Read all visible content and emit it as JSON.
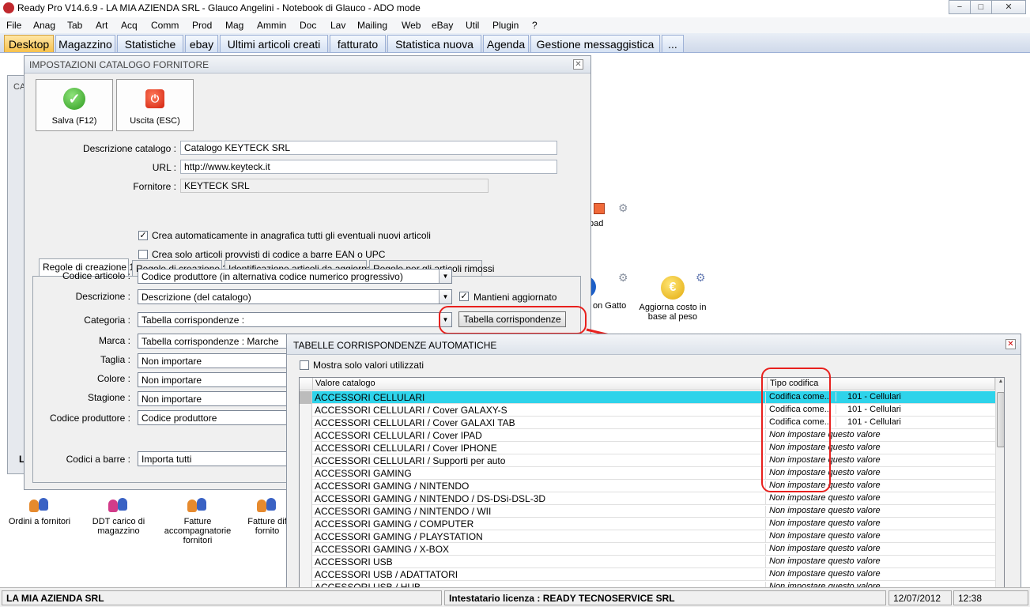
{
  "window": {
    "title": "Ready Pro V14.6.9 - LA MIA AZIENDA SRL - Glauco Angelini - Notebook di Glauco - ADO mode",
    "min": "−",
    "max": "□",
    "close": "✕"
  },
  "menu": [
    "File",
    "Anag",
    "Tab",
    "Art",
    "Acq",
    "Comm",
    "Prod",
    "Mag",
    "Ammin",
    "Doc",
    "Lav",
    "Mailing",
    "Web",
    "eBay",
    "Util",
    "Plugin",
    "?"
  ],
  "tabs": [
    "Desktop",
    "Magazzino",
    "Statistiche",
    "ebay",
    "Ultimi articoli creati",
    "fatturato",
    "Statistica nuova",
    "Agenda",
    "Gestione messaggistica",
    "..."
  ],
  "desktop": {
    "icons": [
      {
        "label": "Ordini a fornitori"
      },
      {
        "label": "DDT carico di magazzino"
      },
      {
        "label": "Fatture accompagnatorie fornitori"
      },
      {
        "label": "Fatture dif fornito"
      },
      {
        "label": "pad"
      },
      {
        "label": "on Gatto"
      },
      {
        "label": "Aggiorna costo in base al peso"
      }
    ],
    "hidden_window_title": "CA",
    "hidden_window_field": "L"
  },
  "catalog_dialog": {
    "title": "IMPOSTAZIONI CATALOGO FORNITORE",
    "save_label": "Salva (F12)",
    "exit_label": "Uscita (ESC)",
    "descrizione_label": "Descrizione catalogo :",
    "descrizione_value": "Catalogo KEYTECK SRL",
    "url_label": "URL :",
    "url_value": "http://www.keyteck.it",
    "fornitore_label": "Fornitore :",
    "fornitore_value": "KEYTECK SRL",
    "tabs": [
      "Regole di creazione 1",
      "Regole di creazione 2",
      "Identificazione articoli da aggiornare",
      "Regole per gli articoli rimossi"
    ],
    "check_auto_create": "Crea automaticamente in anagrafica tutti gli eventuali nuovi articoli",
    "check_only_ean": "Crea solo articoli provvisti di codice a barre EAN o UPC",
    "rows": [
      {
        "label": "Codice articolo :",
        "value": "Codice produttore (in alternativa codice numerico progressivo)"
      },
      {
        "label": "Descrizione :",
        "value": "Descrizione (del catalogo)"
      },
      {
        "label": "Categoria :",
        "value": "Tabella corrispondenze :"
      },
      {
        "label": "Marca :",
        "value": "Tabella corrispondenze : Marche"
      },
      {
        "label": "Taglia :",
        "value": "Non importare"
      },
      {
        "label": "Colore :",
        "value": "Non importare"
      },
      {
        "label": "Stagione :",
        "value": "Non importare"
      },
      {
        "label": "Codice produttore :",
        "value": "Codice produttore"
      },
      {
        "label": "Codici a barre :",
        "value": "Importa tutti"
      }
    ],
    "mantieni_label": "Mantieni aggiornato",
    "tabella_button": "Tabella corrispondenze"
  },
  "table_dialog": {
    "title": "TABELLE CORRISPONDENZE AUTOMATICHE",
    "show_used_label": "Mostra solo valori utilizzati",
    "col_valore": "Valore catalogo",
    "col_tipo": "Tipo codifica",
    "rows": [
      {
        "valore": "ACCESSORI CELLULARI",
        "tipo": "Codifica come...",
        "codice": "101 - Cellulari"
      },
      {
        "valore": "ACCESSORI CELLULARI / Cover  GALAXY-S",
        "tipo": "Codifica come...",
        "codice": "101 - Cellulari"
      },
      {
        "valore": "ACCESSORI CELLULARI / Cover GALAXI TAB",
        "tipo": "Codifica come...",
        "codice": "101 - Cellulari"
      },
      {
        "valore": "ACCESSORI CELLULARI / Cover IPAD",
        "tipo": "Non impostare questo valore",
        "codice": ""
      },
      {
        "valore": "ACCESSORI CELLULARI / Cover IPHONE",
        "tipo": "Non impostare questo valore",
        "codice": ""
      },
      {
        "valore": "ACCESSORI CELLULARI / Supporti per auto",
        "tipo": "Non impostare questo valore",
        "codice": ""
      },
      {
        "valore": "ACCESSORI GAMING",
        "tipo": "Non impostare questo valore",
        "codice": ""
      },
      {
        "valore": "ACCESSORI GAMING / NINTENDO",
        "tipo": "Non impostare questo valore",
        "codice": ""
      },
      {
        "valore": "ACCESSORI GAMING / NINTENDO / DS-DSi-DSL-3D",
        "tipo": "Non impostare questo valore",
        "codice": ""
      },
      {
        "valore": "ACCESSORI GAMING / NINTENDO / WII",
        "tipo": "Non impostare questo valore",
        "codice": ""
      },
      {
        "valore": "ACCESSORI GAMING / COMPUTER",
        "tipo": "Non impostare questo valore",
        "codice": ""
      },
      {
        "valore": "ACCESSORI GAMING / PLAYSTATION",
        "tipo": "Non impostare questo valore",
        "codice": ""
      },
      {
        "valore": "ACCESSORI GAMING / X-BOX",
        "tipo": "Non impostare questo valore",
        "codice": ""
      },
      {
        "valore": "ACCESSORI USB",
        "tipo": "Non impostare questo valore",
        "codice": ""
      },
      {
        "valore": "ACCESSORI USB / ADATTATORI",
        "tipo": "Non impostare questo valore",
        "codice": ""
      },
      {
        "valore": "ACCESSORI USB / HUB",
        "tipo": "Non impostare questo valore",
        "codice": ""
      }
    ]
  },
  "statusbar": {
    "company": "LA MIA AZIENDA SRL",
    "license": "Intestatario licenza : READY TECNOSERVICE SRL",
    "date": "12/07/2012",
    "time": "12:38"
  },
  "colors": {
    "accent_tab": "#f7c14b",
    "selected_row": "#2ed3ea",
    "annotation": "#e8201d"
  }
}
